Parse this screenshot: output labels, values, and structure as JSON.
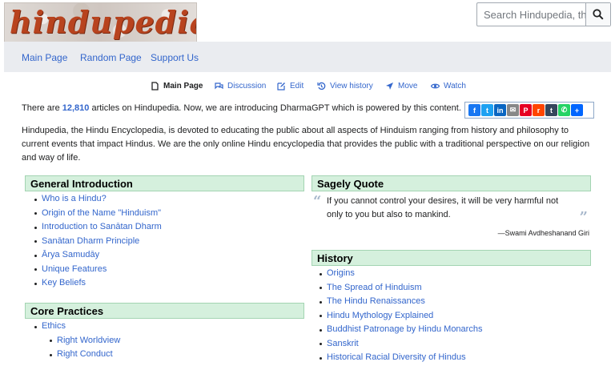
{
  "logo": {
    "text": "hindupedia"
  },
  "search": {
    "placeholder": "Search Hindupedia, the"
  },
  "nav": {
    "items": [
      "Main Page",
      "Random Page",
      "Support Us"
    ]
  },
  "actions": [
    {
      "label": "Main Page",
      "icon": "page-icon",
      "current": true
    },
    {
      "label": "Discussion",
      "icon": "discussion-icon"
    },
    {
      "label": "Edit",
      "icon": "edit-icon"
    },
    {
      "label": "View history",
      "icon": "history-icon"
    },
    {
      "label": "Move",
      "icon": "move-icon"
    },
    {
      "label": "Watch",
      "icon": "eye-icon"
    }
  ],
  "share": [
    {
      "name": "facebook-icon",
      "glyph": "f",
      "color": "#1877f2"
    },
    {
      "name": "twitter-icon",
      "glyph": "t",
      "color": "#1da1f2"
    },
    {
      "name": "linkedin-icon",
      "glyph": "in",
      "color": "#0a66c2"
    },
    {
      "name": "email-icon",
      "glyph": "✉",
      "color": "#888888"
    },
    {
      "name": "pinterest-icon",
      "glyph": "P",
      "color": "#e60023"
    },
    {
      "name": "reddit-icon",
      "glyph": "r",
      "color": "#ff4500"
    },
    {
      "name": "tumblr-icon",
      "glyph": "t",
      "color": "#35465c"
    },
    {
      "name": "whatsapp-icon",
      "glyph": "✆",
      "color": "#25d366"
    },
    {
      "name": "add-share-icon",
      "glyph": "+",
      "color": "#0166ff"
    }
  ],
  "intro": {
    "before": "There are ",
    "count": "12,810",
    "after": " articles on Hindupedia. Now, we are introducing DharmaGPT which is powered by this content."
  },
  "description": "Hindupedia, the Hindu Encyclopedia, is devoted to educating the public about all aspects of Hinduism ranging from history and philosophy to current events that impact Hindus. We are the only online Hindu encyclopedia that provides the public with a traditional perspective on our religion and way of life.",
  "general": {
    "title": "General Introduction",
    "items": [
      "Who is a Hindu?",
      "Origin of the Name \"Hinduism\"",
      "Introduction to Sanātan Dharm",
      "Sanātan Dharm Principle",
      "Ārya Samudāy",
      "Unique Features",
      "Key Beliefs"
    ]
  },
  "core": {
    "title": "Core Practices",
    "items": [
      "Ethics"
    ],
    "subitems": [
      "Right Worldview",
      "Right Conduct"
    ]
  },
  "sagely": {
    "title": "Sagely Quote",
    "quote": "If you cannot control your desires, it will be very harmful not only to you but also to mankind.",
    "author": "—Swami Avdheshanand Giri"
  },
  "history": {
    "title": "History",
    "items": [
      "Origins",
      "The Spread of Hinduism",
      "The Hindu Renaissances",
      "Hindu Mythology Explained",
      "Buddhist Patronage by Hindu Monarchs",
      "Sanskrit",
      "Historical Racial Diversity of Hindus"
    ]
  },
  "colors": {
    "link": "#3366cc",
    "box_header": "#d5f0dd",
    "nav_bg": "#eaecf0"
  }
}
